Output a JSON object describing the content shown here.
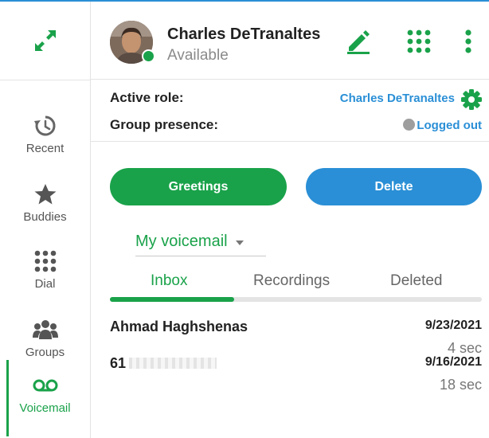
{
  "header": {
    "user_name": "Charles DeTranaltes",
    "user_status": "Available",
    "icons": [
      "expand-icon",
      "edit-icon",
      "dialpad-icon",
      "more-vertical-icon"
    ]
  },
  "nav": {
    "items": [
      {
        "label": "Recent",
        "icon": "history-icon"
      },
      {
        "label": "Buddies",
        "icon": "star-icon"
      },
      {
        "label": "Dial",
        "icon": "dialpad-icon"
      },
      {
        "label": "Groups",
        "icon": "group-icon"
      },
      {
        "label": "Voicemail",
        "icon": "voicemail-icon",
        "active": true
      }
    ]
  },
  "role": {
    "active_role_label": "Active role:",
    "active_role_value": "Charles DeTranaltes",
    "group_presence_label": "Group presence:",
    "group_presence_value": "Logged out"
  },
  "actions": {
    "greetings_label": "Greetings",
    "delete_label": "Delete"
  },
  "voicemail": {
    "selected": "My voicemail",
    "tabs": [
      {
        "label": "Inbox",
        "active": true
      },
      {
        "label": "Recordings",
        "active": false
      },
      {
        "label": "Deleted",
        "active": false
      }
    ],
    "messages": [
      {
        "caller": "Ahmad Haghshenas",
        "date": "9/23/2021",
        "duration": "4 sec"
      },
      {
        "caller": "61",
        "date": "9/16/2021",
        "duration": "18 sec"
      }
    ]
  },
  "colors": {
    "green": "#1aa24a",
    "blue": "#2a8fd6",
    "gray": "#9e9e9e"
  }
}
